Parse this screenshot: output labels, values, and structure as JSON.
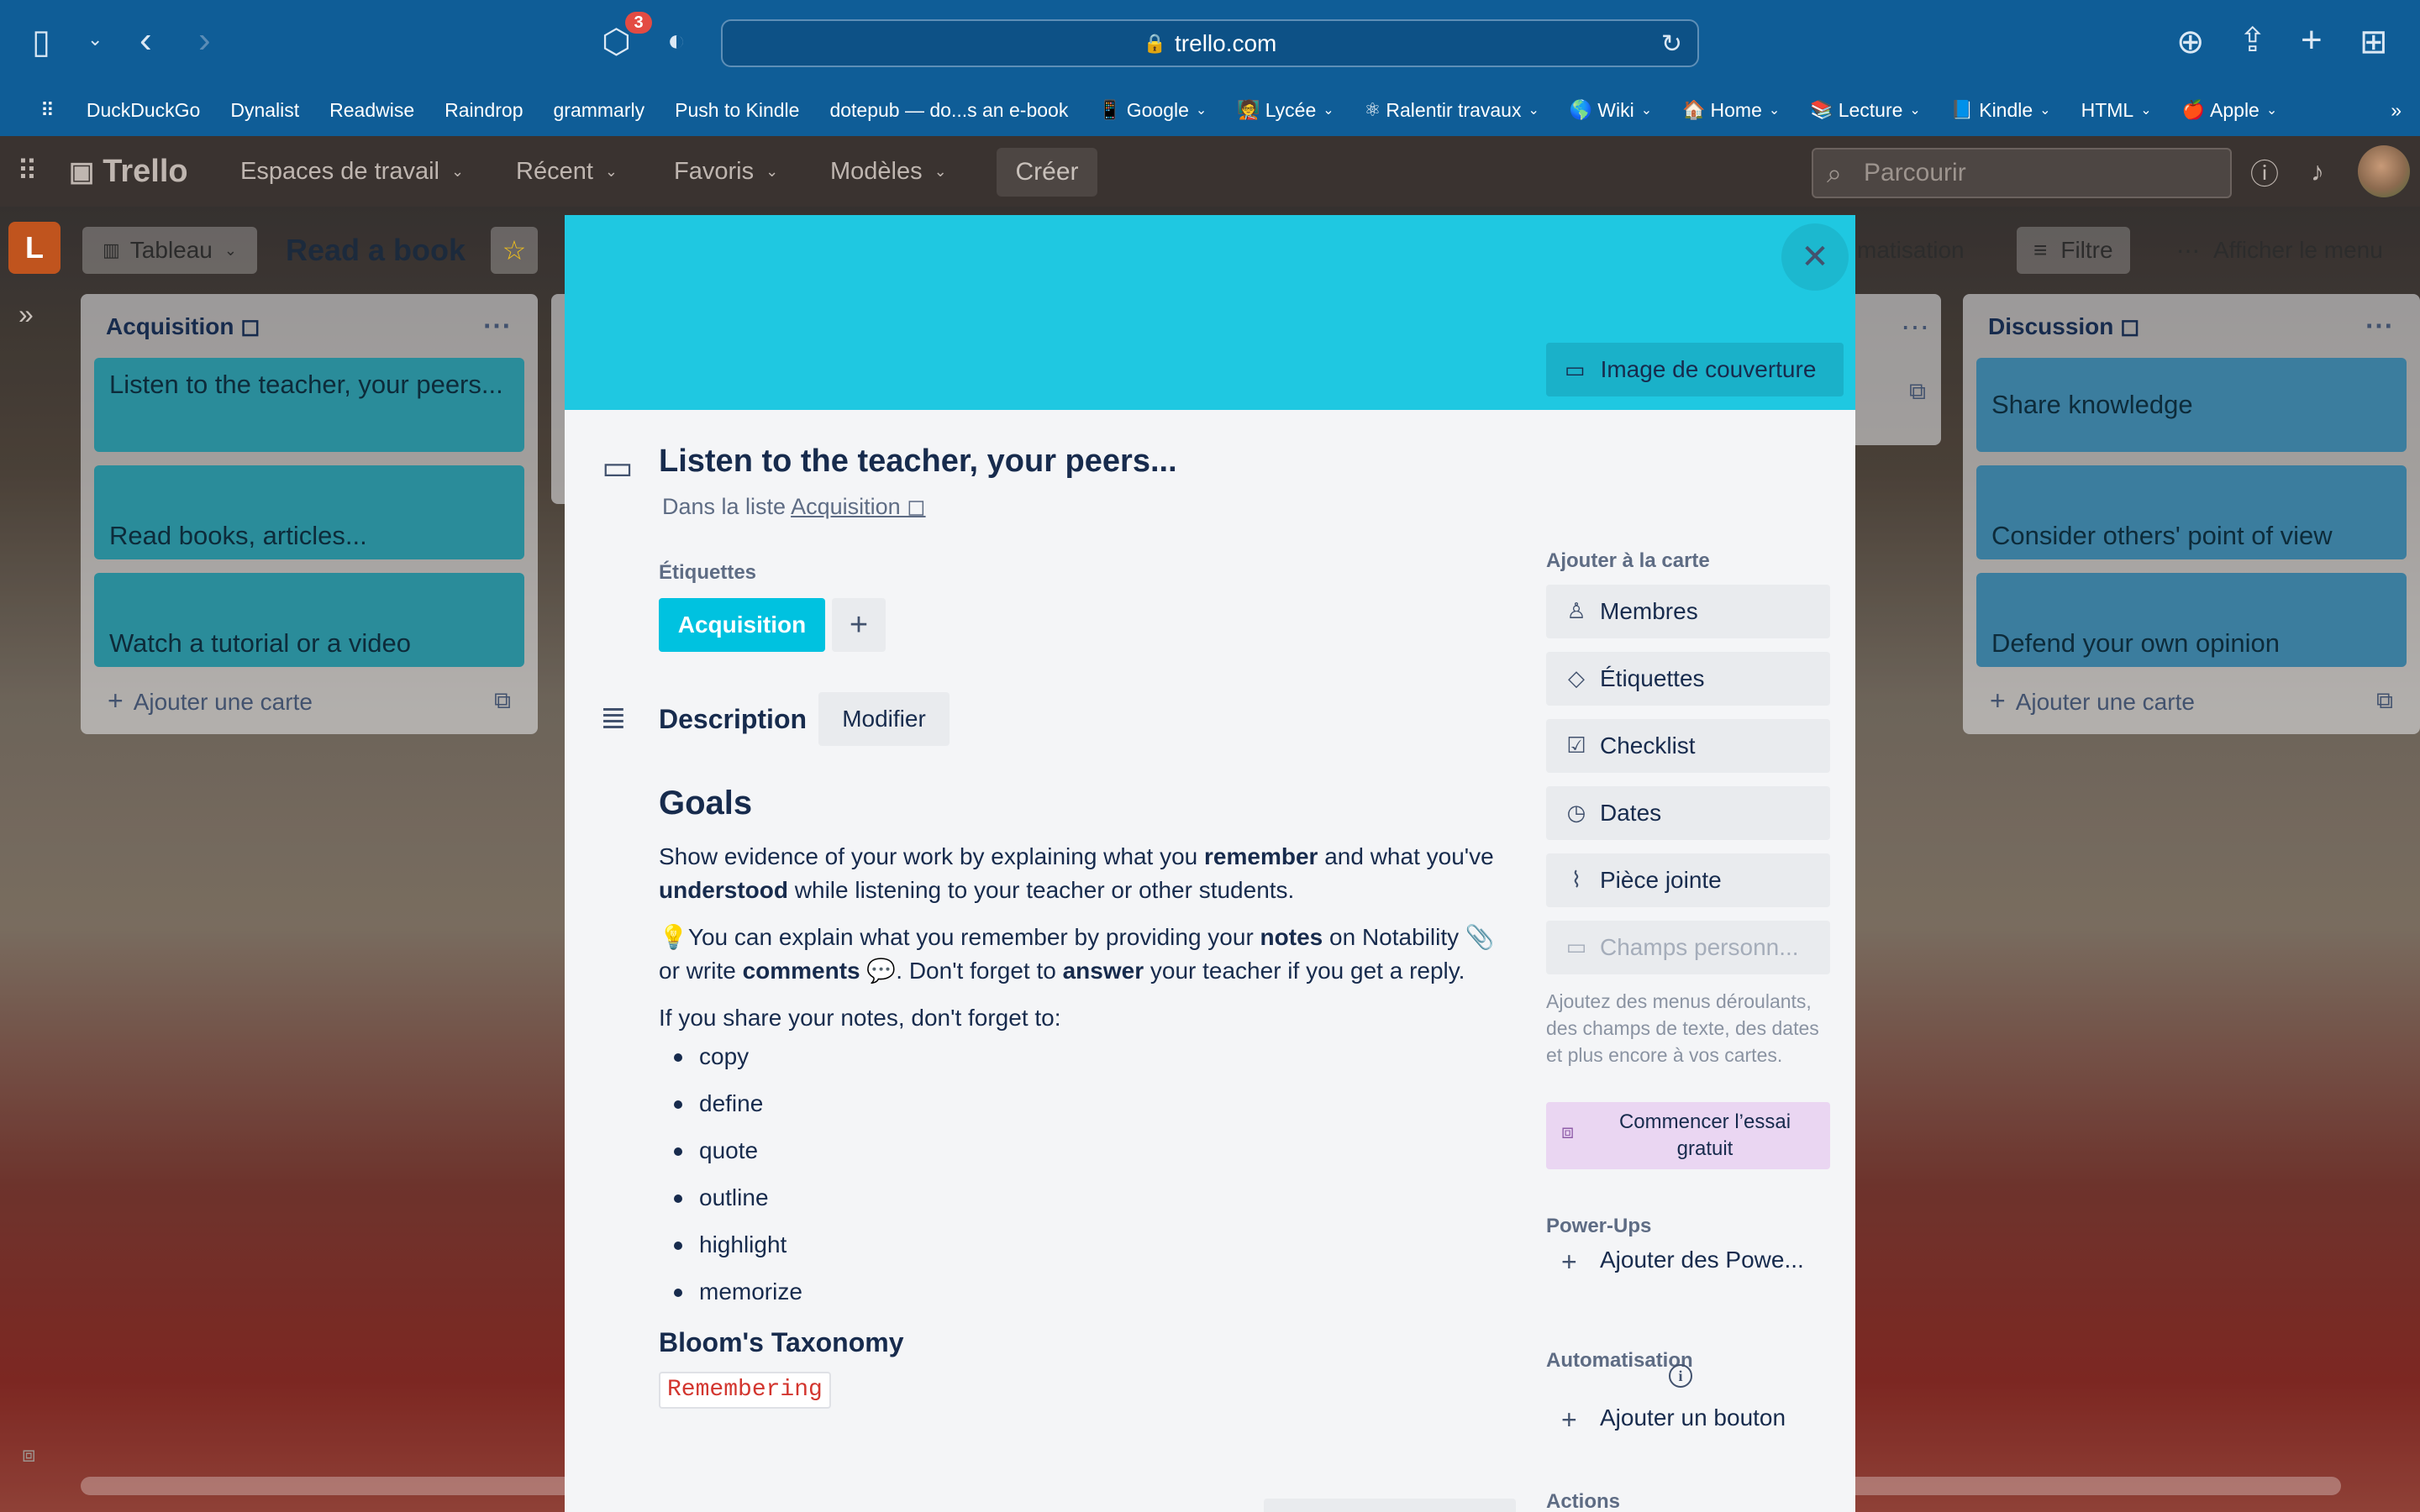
{
  "browser": {
    "url": "trello.com",
    "badge_count": "3",
    "bookmarks": [
      {
        "label": "DuckDuckGo",
        "emoji": "",
        "dropdown": false
      },
      {
        "label": "Dynalist",
        "emoji": "",
        "dropdown": false
      },
      {
        "label": "Readwise",
        "emoji": "",
        "dropdown": false
      },
      {
        "label": "Raindrop",
        "emoji": "",
        "dropdown": false
      },
      {
        "label": "grammarly",
        "emoji": "",
        "dropdown": false
      },
      {
        "label": "Push to Kindle",
        "emoji": "",
        "dropdown": false
      },
      {
        "label": "dotepub — do...s an e-book",
        "emoji": "",
        "dropdown": false
      },
      {
        "label": "Google",
        "emoji": "📱",
        "dropdown": true
      },
      {
        "label": "Lycée",
        "emoji": "🧑‍🏫",
        "dropdown": true
      },
      {
        "label": "Ralentir travaux",
        "emoji": "⚛",
        "dropdown": true
      },
      {
        "label": "Wiki",
        "emoji": "🌎",
        "dropdown": true
      },
      {
        "label": "Home",
        "emoji": "🏠",
        "dropdown": true
      },
      {
        "label": "Lecture",
        "emoji": "📚",
        "dropdown": true
      },
      {
        "label": "Kindle",
        "emoji": "📘",
        "dropdown": true
      },
      {
        "label": "HTML",
        "emoji": "",
        "dropdown": true
      },
      {
        "label": "Apple",
        "emoji": "🍎",
        "dropdown": true
      }
    ]
  },
  "trello_header": {
    "logo": "Trello",
    "workspaces": "Espaces de travail",
    "recent": "Récent",
    "favorites": "Favoris",
    "templates": "Modèles",
    "create": "Créer",
    "search_placeholder": "Parcourir"
  },
  "board": {
    "workspace_initial": "L",
    "view": "Tableau",
    "title": "Read a book",
    "automation_partial": "matisation",
    "filter": "Filtre",
    "show_menu": "Afficher le menu",
    "lists": [
      {
        "title": "Acquisition ◻",
        "cards": [
          "Listen to the teacher, your peers...",
          "Read books, articles...",
          "Watch a tutorial or a video"
        ],
        "add_card": "Ajouter une carte"
      },
      {
        "title": "Discussion ◻",
        "cards": [
          "Share knowledge",
          "Consider others' point of view",
          "Defend your own opinion"
        ],
        "add_card": "Ajouter une carte"
      }
    ]
  },
  "modal": {
    "cover_button": "Image de couverture",
    "title": "Listen to the teacher, your peers...",
    "in_list_prefix": "Dans la liste",
    "in_list_name": "Acquisition ◻",
    "labels_heading": "Étiquettes",
    "label_chip": "Acquisition",
    "description_heading": "Description",
    "edit_button": "Modifier",
    "description": {
      "heading": "Goals",
      "p1_a": "Show evidence of your work by explaining what you ",
      "p1_b": "remember",
      "p1_c": " and what you've ",
      "p1_d": "understood",
      "p1_e": " while listening to your teacher or other students.",
      "p2_a": "💡You can explain what you remember by providing your ",
      "p2_b": "notes",
      "p2_c": " on Notability 📎 or write ",
      "p2_d": "comments",
      "p2_e": " 💬. Don't forget to ",
      "p2_f": "answer",
      "p2_g": " your teacher if you get a reply.",
      "p3": "If you share your notes, don't forget to:",
      "items": [
        "copy",
        "define",
        "quote",
        "outline",
        "highlight",
        "memorize"
      ],
      "bloom_heading": "Bloom's Taxonomy",
      "bloom_tag": "Remembering"
    },
    "sidebar": {
      "add_to_card": "Ajouter à la carte",
      "members": "Membres",
      "labels": "Étiquettes",
      "checklist": "Checklist",
      "dates": "Dates",
      "attachment": "Pièce jointe",
      "custom_fields": "Champs personn...",
      "hint": "Ajoutez des menus déroulants, des champs de texte, des dates et plus encore à vos cartes.",
      "trial": "Commencer l’essai gratuit",
      "powerups_heading": "Power-Ups",
      "add_powerups": "Ajouter des Powe...",
      "automation_heading": "Automatisation",
      "add_button": "Ajouter un bouton",
      "actions_heading": "Actions"
    }
  }
}
